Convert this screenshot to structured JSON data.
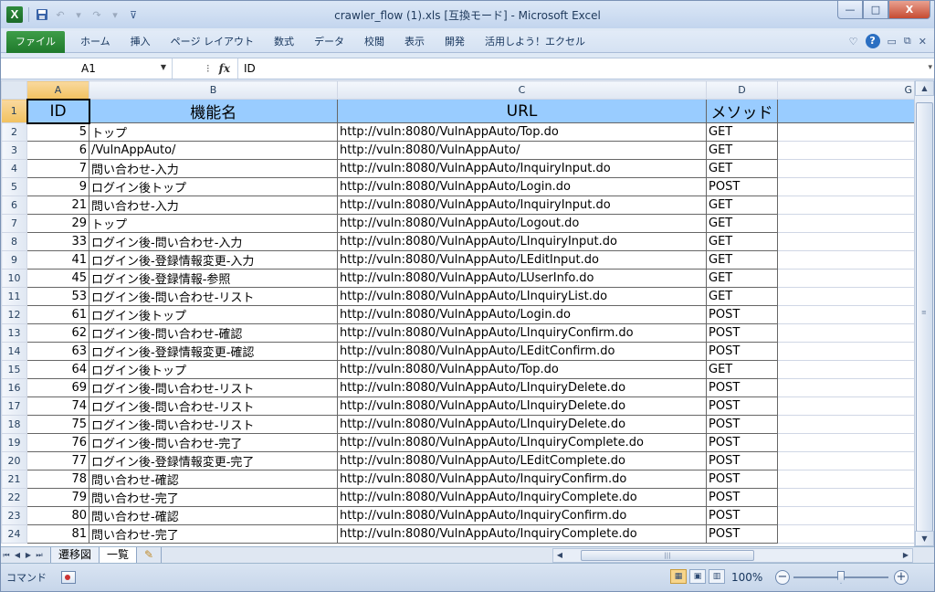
{
  "window": {
    "title": "crawler_flow (1).xls  [互換モード] - Microsoft Excel",
    "app_icon": "X",
    "minimize": "—",
    "maximize": "□",
    "close": "X"
  },
  "ribbon": {
    "file_tab": "ファイル",
    "tabs": [
      "ホーム",
      "挿入",
      "ページ レイアウト",
      "数式",
      "データ",
      "校閲",
      "表示",
      "開発",
      "活用しよう！エクセル"
    ]
  },
  "formula_bar": {
    "name_box": "A1",
    "fx": "fx",
    "content": "ID"
  },
  "sheet": {
    "column_letters": [
      "A",
      "B",
      "C",
      "D",
      "G"
    ],
    "headers": [
      "ID",
      "機能名",
      "URL",
      "メソッド"
    ],
    "rows": [
      {
        "row": "2",
        "id": "5",
        "name": "トップ",
        "url": "http://vuln:8080/VulnAppAuto/Top.do",
        "method": "GET"
      },
      {
        "row": "3",
        "id": "6",
        "name": "/VulnAppAuto/",
        "url": "http://vuln:8080/VulnAppAuto/",
        "method": "GET"
      },
      {
        "row": "4",
        "id": "7",
        "name": "問い合わせ-入力",
        "url": "http://vuln:8080/VulnAppAuto/InquiryInput.do",
        "method": "GET"
      },
      {
        "row": "5",
        "id": "9",
        "name": "ログイン後トップ",
        "url": "http://vuln:8080/VulnAppAuto/Login.do",
        "method": "POST"
      },
      {
        "row": "6",
        "id": "21",
        "name": "問い合わせ-入力",
        "url": "http://vuln:8080/VulnAppAuto/InquiryInput.do",
        "method": "GET"
      },
      {
        "row": "7",
        "id": "29",
        "name": "トップ",
        "url": "http://vuln:8080/VulnAppAuto/Logout.do",
        "method": "GET"
      },
      {
        "row": "8",
        "id": "33",
        "name": "ログイン後-問い合わせ-入力",
        "url": "http://vuln:8080/VulnAppAuto/LInquiryInput.do",
        "method": "GET"
      },
      {
        "row": "9",
        "id": "41",
        "name": "ログイン後-登録情報変更-入力",
        "url": "http://vuln:8080/VulnAppAuto/LEditInput.do",
        "method": "GET"
      },
      {
        "row": "10",
        "id": "45",
        "name": "ログイン後-登録情報-参照",
        "url": "http://vuln:8080/VulnAppAuto/LUserInfo.do",
        "method": "GET"
      },
      {
        "row": "11",
        "id": "53",
        "name": "ログイン後-問い合わせ-リスト",
        "url": "http://vuln:8080/VulnAppAuto/LInquiryList.do",
        "method": "GET"
      },
      {
        "row": "12",
        "id": "61",
        "name": "ログイン後トップ",
        "url": "http://vuln:8080/VulnAppAuto/Login.do",
        "method": "POST"
      },
      {
        "row": "13",
        "id": "62",
        "name": "ログイン後-問い合わせ-確認",
        "url": "http://vuln:8080/VulnAppAuto/LInquiryConfirm.do",
        "method": "POST"
      },
      {
        "row": "14",
        "id": "63",
        "name": "ログイン後-登録情報変更-確認",
        "url": "http://vuln:8080/VulnAppAuto/LEditConfirm.do",
        "method": "POST"
      },
      {
        "row": "15",
        "id": "64",
        "name": "ログイン後トップ",
        "url": "http://vuln:8080/VulnAppAuto/Top.do",
        "method": "GET"
      },
      {
        "row": "16",
        "id": "69",
        "name": "ログイン後-問い合わせ-リスト",
        "url": "http://vuln:8080/VulnAppAuto/LInquiryDelete.do",
        "method": "POST"
      },
      {
        "row": "17",
        "id": "74",
        "name": "ログイン後-問い合わせ-リスト",
        "url": "http://vuln:8080/VulnAppAuto/LInquiryDelete.do",
        "method": "POST"
      },
      {
        "row": "18",
        "id": "75",
        "name": "ログイン後-問い合わせ-リスト",
        "url": "http://vuln:8080/VulnAppAuto/LInquiryDelete.do",
        "method": "POST"
      },
      {
        "row": "19",
        "id": "76",
        "name": "ログイン後-問い合わせ-完了",
        "url": "http://vuln:8080/VulnAppAuto/LInquiryComplete.do",
        "method": "POST"
      },
      {
        "row": "20",
        "id": "77",
        "name": "ログイン後-登録情報変更-完了",
        "url": "http://vuln:8080/VulnAppAuto/LEditComplete.do",
        "method": "POST"
      },
      {
        "row": "21",
        "id": "78",
        "name": "問い合わせ-確認",
        "url": "http://vuln:8080/VulnAppAuto/InquiryConfirm.do",
        "method": "POST"
      },
      {
        "row": "22",
        "id": "79",
        "name": "問い合わせ-完了",
        "url": "http://vuln:8080/VulnAppAuto/InquiryComplete.do",
        "method": "POST"
      },
      {
        "row": "23",
        "id": "80",
        "name": "問い合わせ-確認",
        "url": "http://vuln:8080/VulnAppAuto/InquiryConfirm.do",
        "method": "POST"
      },
      {
        "row": "24",
        "id": "81",
        "name": "問い合わせ-完了",
        "url": "http://vuln:8080/VulnAppAuto/InquiryComplete.do",
        "method": "POST"
      }
    ],
    "header_fill": "#99ccff"
  },
  "sheet_tabs": [
    "遷移図",
    "一覧"
  ],
  "active_sheet": "一覧",
  "status": {
    "mode": "コマンド",
    "zoom": "100%"
  }
}
